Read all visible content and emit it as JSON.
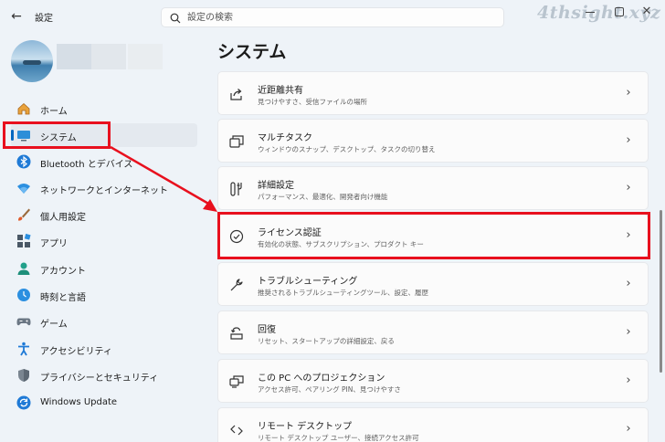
{
  "window": {
    "app_title": "設定",
    "watermark": "4thsight.xyz"
  },
  "search": {
    "placeholder": "設定の検索"
  },
  "colors": {
    "accent": "#0067c0",
    "highlight": "#e8101e",
    "background": "#eef3f8",
    "card": "#fbfbfb"
  },
  "sidebar": {
    "items": [
      {
        "label": "ホーム",
        "icon": "home-icon"
      },
      {
        "label": "システム",
        "icon": "system-monitor-icon",
        "selected": true
      },
      {
        "label": "Bluetooth とデバイス",
        "icon": "bluetooth-icon"
      },
      {
        "label": "ネットワークとインターネット",
        "icon": "wifi-icon"
      },
      {
        "label": "個人用設定",
        "icon": "brush-icon"
      },
      {
        "label": "アプリ",
        "icon": "apps-icon"
      },
      {
        "label": "アカウント",
        "icon": "account-icon"
      },
      {
        "label": "時刻と言語",
        "icon": "time-language-icon"
      },
      {
        "label": "ゲーム",
        "icon": "gamepad-icon"
      },
      {
        "label": "アクセシビリティ",
        "icon": "accessibility-icon"
      },
      {
        "label": "プライバシーとセキュリティ",
        "icon": "shield-icon"
      },
      {
        "label": "Windows Update",
        "icon": "update-icon"
      }
    ]
  },
  "main": {
    "title": "システム",
    "cards": [
      {
        "title": "近距離共有",
        "subtitle": "見つけやすさ、受信ファイルの場所",
        "icon": "share-icon"
      },
      {
        "title": "マルチタスク",
        "subtitle": "ウィンドウのスナップ、デスクトップ、タスクの切り替え",
        "icon": "multitasking-icon"
      },
      {
        "title": "詳細設定",
        "subtitle": "パフォーマンス、最適化、開発者向け機能",
        "icon": "advanced-settings-icon"
      },
      {
        "title": "ライセンス認証",
        "subtitle": "有効化の状態、サブスクリプション、プロダクト キー",
        "icon": "activation-check-icon",
        "highlighted": true
      },
      {
        "title": "トラブルシューティング",
        "subtitle": "推奨されるトラブルシューティングツール、設定、履歴",
        "icon": "wrench-icon"
      },
      {
        "title": "回復",
        "subtitle": "リセット、スタートアップの詳細設定、戻る",
        "icon": "recovery-icon"
      },
      {
        "title": "この PC へのプロジェクション",
        "subtitle": "アクセス許可、ペアリング PIN、見つけやすさ",
        "icon": "projection-icon"
      },
      {
        "title": "リモート デスクトップ",
        "subtitle": "リモート デスクトップ ユーザー、接続アクセス許可",
        "icon": "remote-desktop-icon"
      }
    ]
  }
}
